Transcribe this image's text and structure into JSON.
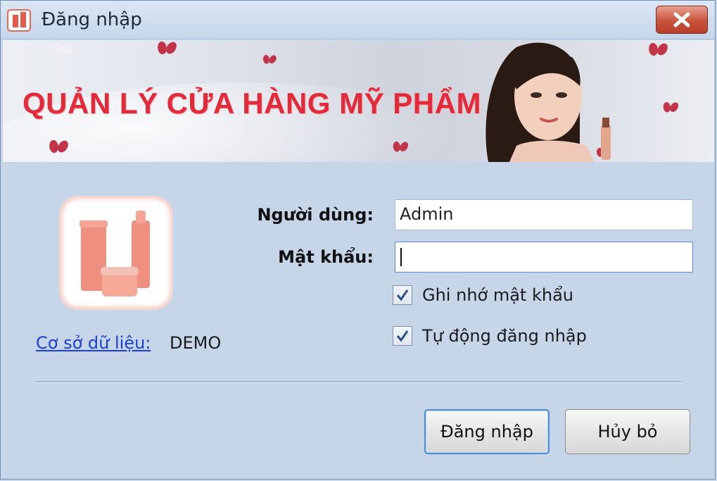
{
  "window": {
    "title": "Đăng nhập"
  },
  "banner": {
    "title": "QUẢN LÝ CỬA HÀNG MỸ PHẨM"
  },
  "form": {
    "username_label": "Người dùng:",
    "username_value": "Admin",
    "password_label": "Mật khẩu:",
    "password_value": "",
    "remember_label": "Ghi nhớ mật khẩu",
    "remember_checked": true,
    "auto_login_label": "Tự động đăng nhập",
    "auto_login_checked": true
  },
  "database": {
    "link_label": "Cơ sở dữ liệu:",
    "value": "DEMO"
  },
  "buttons": {
    "login_label": "Đăng nhập",
    "cancel_label": "Hủy bỏ"
  },
  "colors": {
    "accent_red": "#e32a3a",
    "link_blue": "#1a3fd6",
    "window_bg": "#c6d5e8"
  }
}
